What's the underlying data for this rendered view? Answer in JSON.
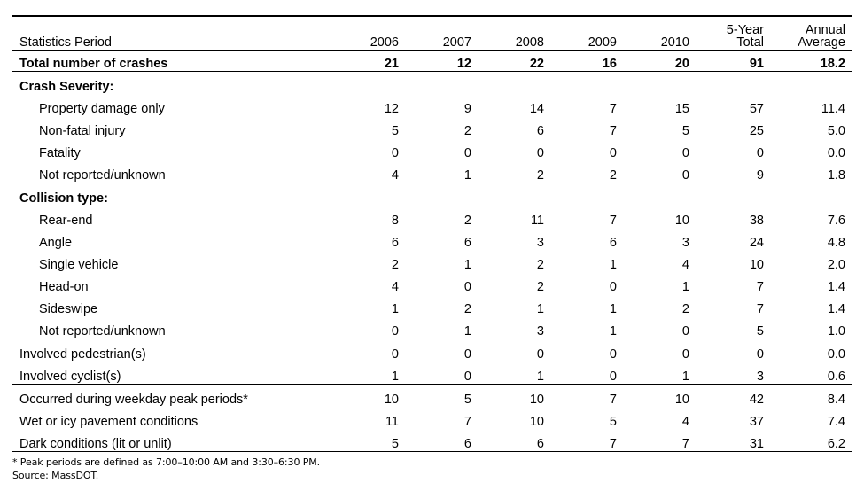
{
  "table": {
    "columns": [
      {
        "id": "label",
        "header": "Statistics Period"
      },
      {
        "id": "y2006",
        "header": "2006"
      },
      {
        "id": "y2007",
        "header": "2007"
      },
      {
        "id": "y2008",
        "header": "2008"
      },
      {
        "id": "y2009",
        "header": "2009"
      },
      {
        "id": "y2010",
        "header": "2010"
      },
      {
        "id": "total",
        "header_line1": "5-Year",
        "header_line2": "Total"
      },
      {
        "id": "average",
        "header_line1": "Annual",
        "header_line2": "Average"
      }
    ],
    "total_row": {
      "label": "Total number of crashes",
      "values": [
        "21",
        "12",
        "22",
        "16",
        "20",
        "91",
        "18.2"
      ]
    },
    "sections": [
      {
        "heading": "Crash Severity:",
        "rows": [
          {
            "label": "Property damage only",
            "values": [
              "12",
              "9",
              "14",
              "7",
              "15",
              "57",
              "11.4"
            ]
          },
          {
            "label": "Non-fatal injury",
            "values": [
              "5",
              "2",
              "6",
              "7",
              "5",
              "25",
              "5.0"
            ]
          },
          {
            "label": "Fatality",
            "values": [
              "0",
              "0",
              "0",
              "0",
              "0",
              "0",
              "0.0"
            ]
          },
          {
            "label": "Not reported/unknown",
            "values": [
              "4",
              "1",
              "2",
              "2",
              "0",
              "9",
              "1.8"
            ]
          }
        ]
      },
      {
        "heading": "Collision type:",
        "rows": [
          {
            "label": "Rear-end",
            "values": [
              "8",
              "2",
              "11",
              "7",
              "10",
              "38",
              "7.6"
            ]
          },
          {
            "label": "Angle",
            "values": [
              "6",
              "6",
              "3",
              "6",
              "3",
              "24",
              "4.8"
            ]
          },
          {
            "label": "Single vehicle",
            "values": [
              "2",
              "1",
              "2",
              "1",
              "4",
              "10",
              "2.0"
            ]
          },
          {
            "label": "Head-on",
            "values": [
              "4",
              "0",
              "2",
              "0",
              "1",
              "7",
              "1.4"
            ]
          },
          {
            "label": "Sideswipe",
            "values": [
              "1",
              "2",
              "1",
              "1",
              "2",
              "7",
              "1.4"
            ]
          },
          {
            "label": "Not reported/unknown",
            "values": [
              "0",
              "1",
              "3",
              "1",
              "0",
              "5",
              "1.0"
            ]
          }
        ]
      }
    ],
    "involved_rows": [
      {
        "label": "Involved pedestrian(s)",
        "values": [
          "0",
          "0",
          "0",
          "0",
          "0",
          "0",
          "0.0"
        ]
      },
      {
        "label": "Involved cyclist(s)",
        "values": [
          "1",
          "0",
          "1",
          "0",
          "1",
          "3",
          "0.6"
        ]
      }
    ],
    "condition_rows": [
      {
        "label": "Occurred during weekday peak periods*",
        "values": [
          "10",
          "5",
          "10",
          "7",
          "10",
          "42",
          "8.4"
        ]
      },
      {
        "label": "Wet or icy pavement conditions",
        "values": [
          "11",
          "7",
          "10",
          "5",
          "4",
          "37",
          "7.4"
        ]
      },
      {
        "label": "Dark conditions (lit or unlit)",
        "values": [
          "5",
          "6",
          "6",
          "7",
          "7",
          "31",
          "6.2"
        ]
      }
    ]
  },
  "notes": {
    "footnote": "* Peak periods are defined as 7:00–10:00 AM and 3:30–6:30 PM.",
    "source": "Source: MassDOT."
  }
}
